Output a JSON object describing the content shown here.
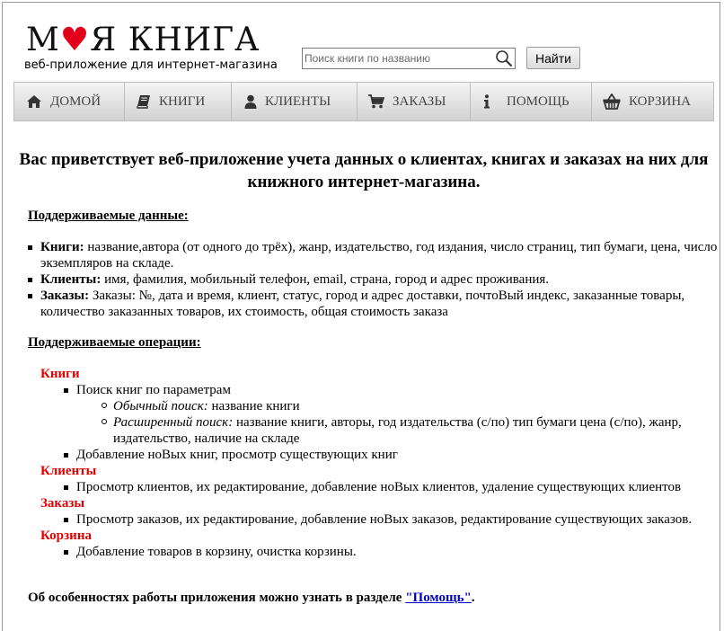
{
  "header": {
    "logo_text_1": "М",
    "logo_text_2": "Я КНИГА",
    "tagline": "веб-приложение для интернет-магазина",
    "search_placeholder": "Поиск книги по названию",
    "search_button": "Найти"
  },
  "nav": [
    {
      "label": "Домой",
      "icon": "home-icon"
    },
    {
      "label": "Книги",
      "icon": "book-icon"
    },
    {
      "label": "Клиенты",
      "icon": "user-icon"
    },
    {
      "label": "Заказы",
      "icon": "cart-icon"
    },
    {
      "label": "Помощь",
      "icon": "info-icon"
    },
    {
      "label": "Корзина",
      "icon": "basket-icon"
    }
  ],
  "main": {
    "title": "Вас приветствует веб-приложение учета данных о клиентах, книгах и заказах на них для книжного интернет-магазина.",
    "data_heading": "Поддерживаемые данные:",
    "data_items": [
      {
        "term": "Книги:",
        "text": " название,автора (от одного до трёх), жанр, издательство, год издания, число страниц, тип бумаги, цена, число экземпляров на складе."
      },
      {
        "term": "Клиенты:",
        "text": " имя, фамилия, мобильный телефон, email, страна, город и адрес проживания."
      },
      {
        "term": "Заказы:",
        "text": " Заказы: №, дата и время, клиент, статус, город и адрес доставки, почтоВый индекс, заказанные товары, количество заказанных товаров, их стоимость, общая стоимость заказа"
      }
    ],
    "ops_heading": "Поддерживаемые операции:",
    "ops": {
      "books": {
        "title": "Книги",
        "search": "Поиск книг по параметрам",
        "simple_label": "Обычный поиск:",
        "simple_text": " название книги",
        "advanced_label": "Расширенный поиск:",
        "advanced_text": " название книги, авторы, год издательства (с/по) тип бумаги цена (с/по), жанр, издательство, наличие на складе",
        "add": "Добавление ноВых книг, просмотр существующих книг"
      },
      "clients": {
        "title": "Клиенты",
        "item": "Просмотр клиентов, их редактирование, добавление ноВых клиентов, удаление существующих клиентов"
      },
      "orders": {
        "title": "Заказы",
        "item": "Просмотр заказов, их редактирование, добавление ноВых заказов, редактирование существующих заказов."
      },
      "cart": {
        "title": "Корзина",
        "item": "Добавление товаров в корзину, очистка корзины."
      }
    },
    "footer_text": "Об особенностях работы приложения можно узнать в разделе ",
    "footer_link": "\"Помощь\"",
    "footer_end": "."
  }
}
